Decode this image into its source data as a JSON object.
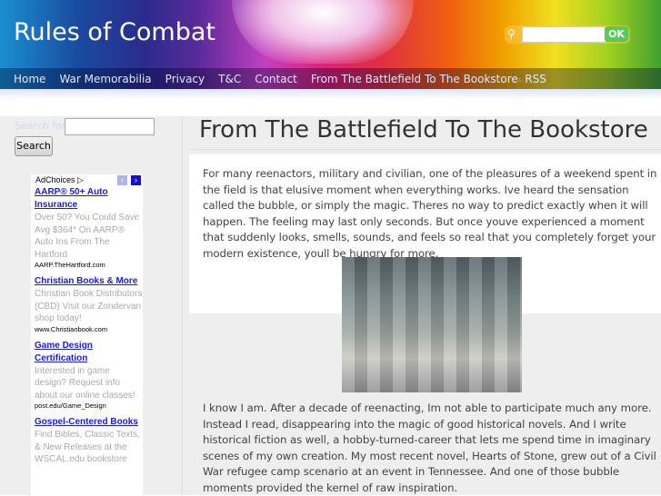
{
  "site": {
    "title": "Rules of Combat",
    "search_ok": "OK",
    "rss": "RSS"
  },
  "nav": [
    "Home",
    "War Memorabilia",
    "Privacy",
    "T&C",
    "Contact",
    "From The Battlefield To The Bookstore"
  ],
  "sidebar": {
    "search_label": "Search for:",
    "search_button": "Search",
    "adchoices": "AdChoices ▷",
    "ads": [
      {
        "title": "AARP® 50+ Auto Insurance",
        "text": "Over 50? You Could Save Avg $364* On AARP® Auto Ins From The Hartford",
        "url": "AARP.TheHartford.com"
      },
      {
        "title": "Christian Books & More",
        "text": "Christian Book Distributors (CBD) Visit our Zondervan shop today!",
        "url": "www.Christianbook.com"
      },
      {
        "title": "Game Design Certification",
        "text": "Interested in game design? Request info about our online classes!",
        "url": "post.edu/Game_Design"
      },
      {
        "title": "Gospel-Centered Books",
        "text": "Find Bibles, Classic Texts, & New Releases at the WSCAL.edu bookstore",
        "url": ""
      }
    ]
  },
  "article": {
    "title": "From The Battlefield To The Bookstore",
    "p1": "For many reenactors, military and civilian, one of the pleasures of a weekend spent in the field is that elusive moment when everything works. Ive heard the sensation called the bubble, or simply the magic. Theres no way to predict exactly when it will happen. The feeling may last only seconds. But once youve experienced a moment that suddenly looks, smells, sounds, and feels so real that you completely forget your modern existence, youll be hungry for more.",
    "p2": "I know I am. After a decade of reenacting, Im not able to participate much any more. Instead I read, disappearing into the magic of good historical novels. And I write historical fiction as well, a hobby-turned-career that lets me spend time in imaginary scenes of my own creation. My most recent novel, Hearts of Stone, grew out of a Civil War refugee camp scenario at an event in Tennessee. And one of those bubble moments provided the kernel of raw inspiration."
  }
}
